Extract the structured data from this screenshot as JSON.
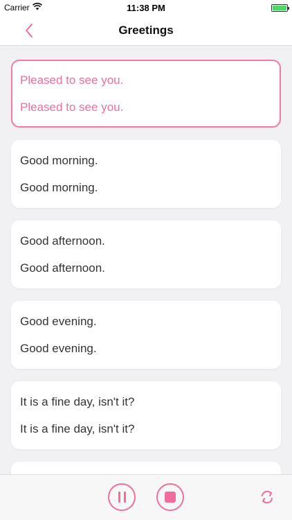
{
  "status_bar": {
    "carrier": "Carrier",
    "time": "11:38 PM"
  },
  "nav": {
    "title": "Greetings",
    "back_icon": "chevron-left-icon"
  },
  "phrases": [
    {
      "line1": "Pleased to see you.",
      "line2": "Pleased to see you.",
      "active": true
    },
    {
      "line1": "Good morning.",
      "line2": "Good morning."
    },
    {
      "line1": "Good afternoon.",
      "line2": "Good afternoon."
    },
    {
      "line1": "Good evening.",
      "line2": "Good evening."
    },
    {
      "line1": "It is a fine day, isn't it?",
      "line2": "It is a fine day, isn't it?"
    }
  ],
  "controls": {
    "pause_icon": "pause-icon",
    "stop_icon": "stop-icon",
    "repeat_icon": "repeat-icon"
  },
  "colors": {
    "accent": "#ef6d9f",
    "battery": "#4cd964"
  }
}
